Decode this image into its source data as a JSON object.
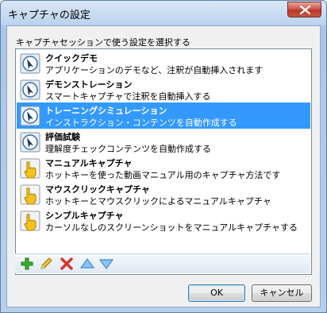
{
  "window": {
    "title": "キャプチャの設定"
  },
  "instruction": "キャプチャセッションで使う設定を選択する",
  "items": [
    {
      "title": "クイックデモ",
      "desc": "アプリケーションのデモなど、注釈が自動挿入されます",
      "icon": "auto-capture-icon",
      "selected": false
    },
    {
      "title": "デモンストレーション",
      "desc": "スマートキャプチャで注釈を自動挿入する",
      "icon": "auto-capture-icon",
      "selected": false
    },
    {
      "title": "トレーニングシミュレーション",
      "desc": "インストラクション・コンテンツを自動作成する",
      "icon": "auto-capture-icon",
      "selected": true
    },
    {
      "title": "評価試験",
      "desc": "理解度チェックコンテンツを自動作成する",
      "icon": "auto-capture-icon",
      "selected": false
    },
    {
      "title": "マニュアルキャプチャ",
      "desc": "ホットキーを使った動画マニュアル用のキャプチャ方法です",
      "icon": "manual-capture-icon",
      "selected": false
    },
    {
      "title": "マウスクリックキャプチャ",
      "desc": "ホットキーとマウスクリックによるマニュアルキャプチャ",
      "icon": "manual-capture-icon",
      "selected": false
    },
    {
      "title": "シンプルキャプチャ",
      "desc": "カーソルなしのスクリーンショットをマニュアルキャプチャする",
      "icon": "manual-capture-icon",
      "selected": false
    }
  ],
  "toolbar": {
    "add": "add-icon",
    "edit": "edit-pencil-icon",
    "delete": "delete-x-icon",
    "move_up": "move-up-arrow-icon",
    "move_down": "move-down-arrow-icon"
  },
  "buttons": {
    "ok": "OK",
    "cancel": "キャンセル"
  },
  "colors": {
    "selection": "#3399ff",
    "close_button": "#c9553f",
    "add": "#3cae2a",
    "delete": "#d8342a",
    "arrows": "#3d8fd6"
  }
}
